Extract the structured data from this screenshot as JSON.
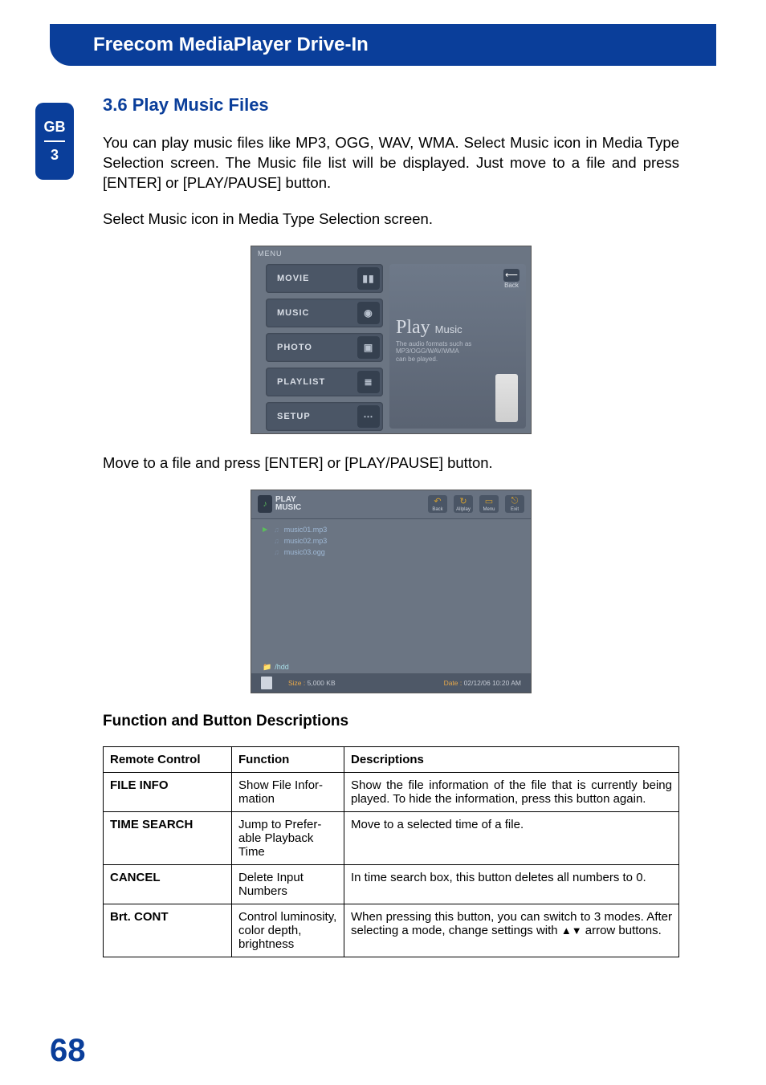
{
  "header": {
    "title": "Freecom MediaPlayer Drive-In"
  },
  "side": {
    "lang": "GB",
    "chapter": "3"
  },
  "section": {
    "heading": "3.6 Play Music Files",
    "intro": "You can play music files like MP3, OGG, WAV, WMA. Select Music icon in Media Type Selection screen. The Music file list will be displayed. Just move to a file and press [ENTER] or [PLAY/PAUSE] button.",
    "step1": "Select Music icon in Media Type Selection screen.",
    "step2": "Move to a file and press [ENTER] or [PLAY/PAUSE] button.",
    "subheading": "Function and Button Descriptions"
  },
  "shot1": {
    "menu_label": "MENU",
    "items": [
      "MOVIE",
      "MUSIC",
      "PHOTO",
      "PLAYLIST",
      "SETUP"
    ],
    "back": "Back",
    "play_title": "Play",
    "play_sub": "Music",
    "desc1": "The audio formats such as",
    "desc2": "MP3/OGG/WAV/WMA",
    "desc3": "can be played."
  },
  "shot2": {
    "badge_top": "PLAY",
    "badge_bottom": "MUSIC",
    "icons": [
      "Back",
      "Allplay",
      "Menu",
      "Exit"
    ],
    "files": [
      "music01.mp3",
      "music02.mp3",
      "music03.ogg"
    ],
    "path": "/hdd",
    "size_label": "Size :",
    "size_value": "5,000 KB",
    "date_label": "Date :",
    "date_value": "02/12/06  10:20  AM"
  },
  "table": {
    "headers": [
      "Remote Control",
      "Function",
      "Descriptions"
    ],
    "rows": [
      {
        "rc": "FILE INFO",
        "fn": "Show File Infor­mation",
        "desc": "Show the file information of the file that is currently being played. To hide the information, press this button again."
      },
      {
        "rc": "TIME SEARCH",
        "fn": "Jump to Prefer­able Playback Time",
        "desc": "Move to a selected time of a file."
      },
      {
        "rc": "CANCEL",
        "fn": "Delete Input Numbers",
        "desc": "In time search box, this button deletes all numbers to 0."
      },
      {
        "rc": "Brt. CONT",
        "fn": "Control luminos­ity, color depth, brightness",
        "desc_pre": "When pressing this button, you can switch to 3 modes. After selecting a mode, change settings with ",
        "desc_post": " arrow buttons."
      }
    ]
  },
  "page_number": "68"
}
